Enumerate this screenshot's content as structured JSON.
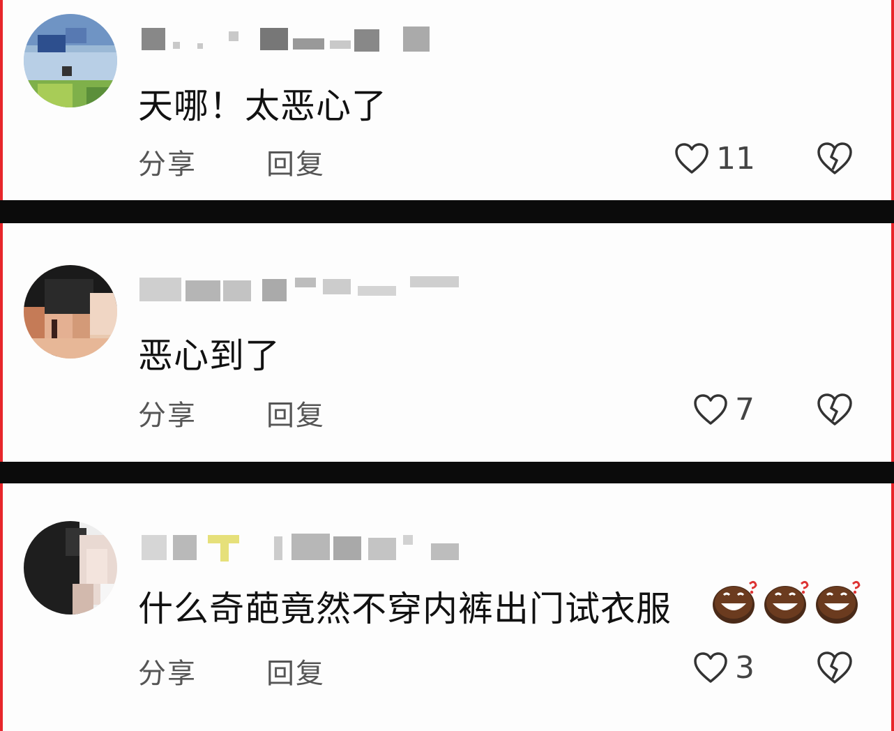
{
  "comments": [
    {
      "text": "天哪！太恶心了",
      "share_label": "分享",
      "reply_label": "回复",
      "likes": "11"
    },
    {
      "text": "恶心到了",
      "share_label": "分享",
      "reply_label": "回复",
      "likes": "7"
    },
    {
      "text": "什么奇葩竟然不穿内裤出门试衣服",
      "share_label": "分享",
      "reply_label": "回复",
      "likes": "3"
    }
  ],
  "icons": {
    "like": "heart-outline-icon",
    "dislike": "broken-heart-icon",
    "emoji": "grinning-face-emoji"
  },
  "colors": {
    "border_accent": "#e8262b",
    "divider": "#0b0b0b",
    "text": "#111111",
    "muted": "#555555"
  }
}
